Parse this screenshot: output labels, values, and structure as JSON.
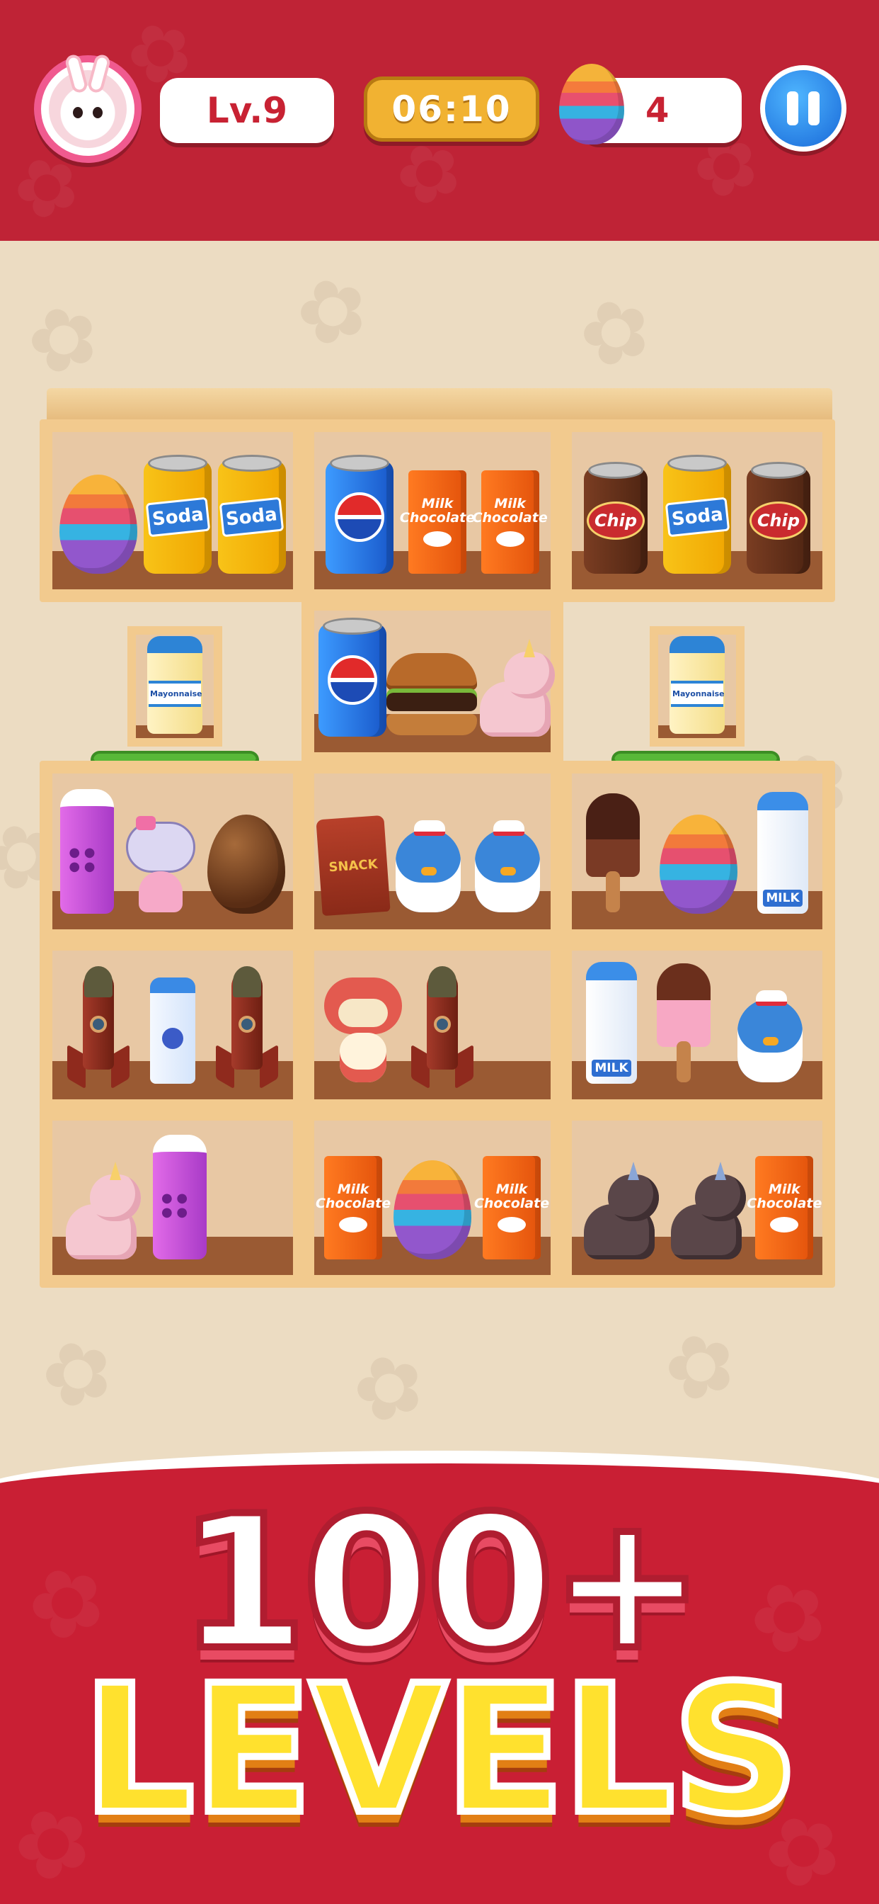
{
  "hud": {
    "level": "Lv.9",
    "timer": "06:10",
    "egg_count": "4"
  },
  "labels": {
    "soda": "Soda",
    "chip": "Chip",
    "milk_chocolate": "Milk Chocolate",
    "mayonnaise": "Mayonnaise",
    "snack": "SNACK",
    "milk": "MILK"
  },
  "shelves": {
    "row1": [
      [
        "egg-rainbow",
        "soda-can",
        "soda-can"
      ],
      [
        "pepsi-can",
        "milk-chocolate",
        "milk-chocolate"
      ],
      [
        "chip-can",
        "soda-can-bunny",
        "chip-can"
      ]
    ],
    "mini_left": [
      "mayonnaise-jar"
    ],
    "row2_middle": [
      "pepsi-can",
      "burger",
      "pink-unicorn"
    ],
    "mini_right": [
      "mayonnaise-jar"
    ],
    "row3": [
      [
        "grape-juice",
        "kitty-doll",
        "egg-chocolate"
      ],
      [
        "snack-bag",
        "penguin",
        "penguin"
      ],
      [
        "chocolate-popsicle",
        "egg-rainbow",
        "milk-bottle"
      ]
    ],
    "row4": [
      [
        "rocket",
        "blueberry-bottle",
        "rocket"
      ],
      [
        "red-toy",
        "rocket"
      ],
      [
        "milk-bottle",
        "pink-popsicle",
        "penguin"
      ]
    ],
    "row5": [
      [
        "pink-unicorn",
        "grape-juice"
      ],
      [
        "milk-chocolate",
        "egg-rainbow",
        "milk-chocolate"
      ],
      [
        "grey-unicorn",
        "grey-unicorn",
        "milk-chocolate"
      ]
    ]
  },
  "banner": {
    "line1": "100+",
    "line2": "LEVELS"
  },
  "colors": {
    "header_red": "#bf2336",
    "background": "#ecdcc2",
    "shelf_wood": "#f2ca8e",
    "title_yellow": "#ffe12e"
  },
  "icons": {
    "avatar": "bunny-avatar-icon",
    "egg": "rainbow-egg-icon",
    "pause": "pause-icon"
  }
}
